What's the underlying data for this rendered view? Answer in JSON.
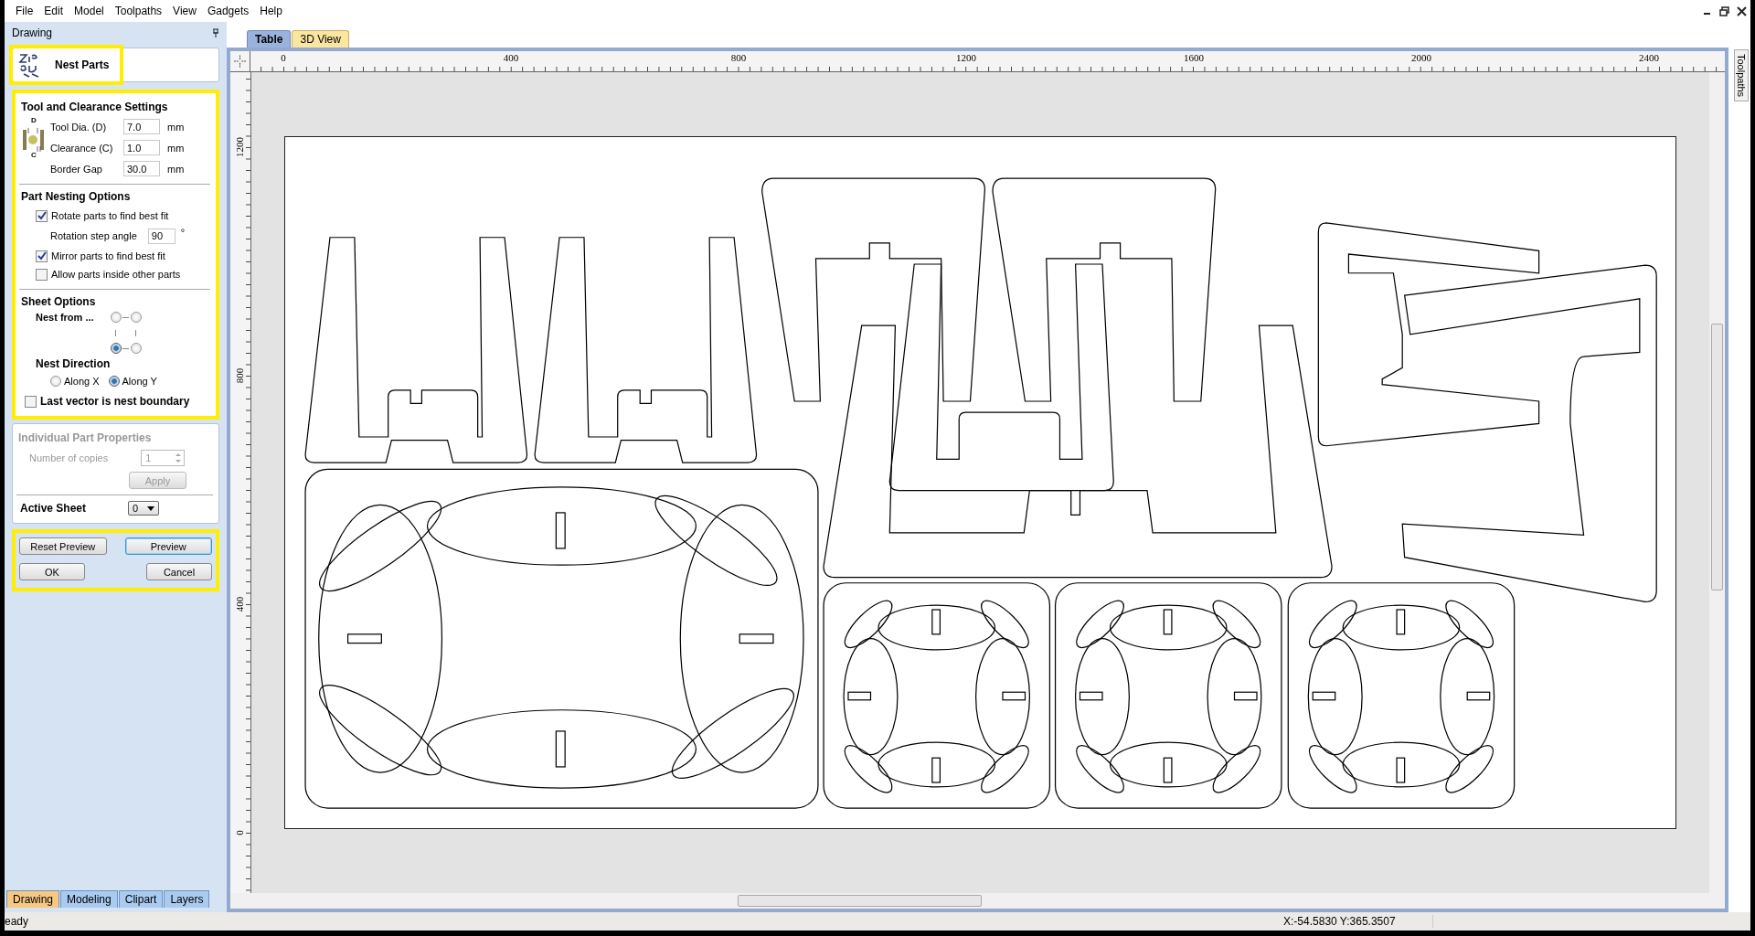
{
  "menu": [
    "File",
    "Edit",
    "Model",
    "Toolpaths",
    "View",
    "Gadgets",
    "Help"
  ],
  "panel_title": "Drawing",
  "nest_parts": {
    "title": "Nest Parts",
    "highlighted": true
  },
  "settings": {
    "highlighted": true,
    "tool": {
      "heading": "Tool and Clearance Settings",
      "diagram_labels": [
        "D",
        "C"
      ],
      "fields": [
        {
          "label": "Tool Dia. (D)",
          "value": "7.0",
          "unit": "mm"
        },
        {
          "label": "Clearance (C)",
          "value": "1.0",
          "unit": "mm"
        },
        {
          "label": "Border Gap",
          "value": "30.0",
          "unit": "mm"
        }
      ]
    },
    "nesting": {
      "heading": "Part Nesting Options",
      "items": [
        {
          "kind": "checkbox",
          "label": "Rotate parts to find best fit",
          "checked": true
        },
        {
          "kind": "number",
          "label": "Rotation step angle",
          "value": "90",
          "unit": "°"
        },
        {
          "kind": "checkbox",
          "label": "Mirror parts to find best fit",
          "checked": true
        },
        {
          "kind": "checkbox",
          "label": "Allow parts inside other parts",
          "checked": false
        }
      ]
    },
    "sheet": {
      "heading": "Sheet Options",
      "nest_from_label": "Nest from ...",
      "corners": [
        {
          "selected": false
        },
        {
          "selected": false
        },
        {
          "selected": true
        },
        {
          "selected": false
        }
      ],
      "direction_label": "Nest Direction",
      "directions": [
        {
          "label": "Along X",
          "selected": false
        },
        {
          "label": "Along Y",
          "selected": true
        }
      ],
      "boundary": {
        "label": "Last vector is nest boundary",
        "checked": false
      }
    }
  },
  "part_properties": {
    "heading": "Individual Part Properties",
    "disabled": true,
    "copies_label": "Number of copies",
    "copies": "1",
    "apply": "Apply"
  },
  "active_sheet": {
    "label": "Active Sheet",
    "value": "0"
  },
  "actions": {
    "highlighted": true,
    "buttons": [
      {
        "label": "Reset Preview",
        "focused": false
      },
      {
        "label": "Preview",
        "focused": true
      },
      {
        "label": "OK",
        "focused": false
      },
      {
        "label": "Cancel",
        "focused": false
      }
    ]
  },
  "panel_tabs": [
    {
      "label": "Drawing",
      "selected": true
    },
    {
      "label": "Modeling",
      "selected": false
    },
    {
      "label": "Clipart",
      "selected": false
    },
    {
      "label": "Layers",
      "selected": false
    }
  ],
  "view_tabs": [
    {
      "label": "Table",
      "selected": true
    },
    {
      "label": "3D View",
      "selected": false
    }
  ],
  "ruler": {
    "x_labels": [
      "0",
      "400",
      "800",
      "1200",
      "1600",
      "2000",
      "2400"
    ],
    "y_labels": [
      "1200",
      "800",
      "400",
      "0"
    ]
  },
  "side_tab": "Toolpaths",
  "status_bar": {
    "message": "eady",
    "coordinates": "X:-54.5830 Y:365.3507"
  }
}
